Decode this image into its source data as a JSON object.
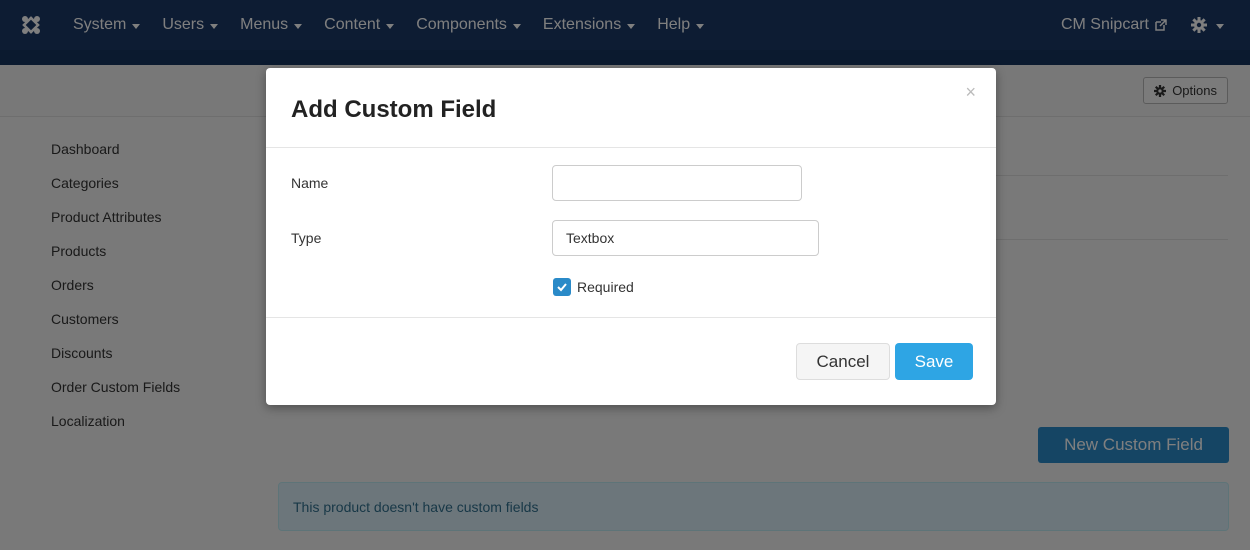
{
  "navbar": {
    "menus": [
      {
        "label": "System"
      },
      {
        "label": "Users"
      },
      {
        "label": "Menus"
      },
      {
        "label": "Content"
      },
      {
        "label": "Components"
      },
      {
        "label": "Extensions"
      },
      {
        "label": "Help"
      }
    ],
    "site_label": "CM Snipcart"
  },
  "toolbar": {
    "options_label": "Options"
  },
  "sidebar": {
    "items": [
      {
        "label": "Dashboard"
      },
      {
        "label": "Categories"
      },
      {
        "label": "Product Attributes"
      },
      {
        "label": "Products"
      },
      {
        "label": "Orders"
      },
      {
        "label": "Customers"
      },
      {
        "label": "Discounts"
      },
      {
        "label": "Order Custom Fields"
      },
      {
        "label": "Localization"
      }
    ]
  },
  "main": {
    "new_field_label": "New Custom Field",
    "empty_message": "This product doesn't have custom fields"
  },
  "modal": {
    "title": "Add Custom Field",
    "close_symbol": "×",
    "name_label": "Name",
    "name_value": "",
    "type_label": "Type",
    "type_value": "Textbox",
    "required_label": "Required",
    "required_checked": true,
    "cancel_label": "Cancel",
    "save_label": "Save"
  },
  "colors": {
    "navbar": "#1a3867",
    "primary": "#2ea5e4",
    "checkbox": "#2a8ac8"
  }
}
